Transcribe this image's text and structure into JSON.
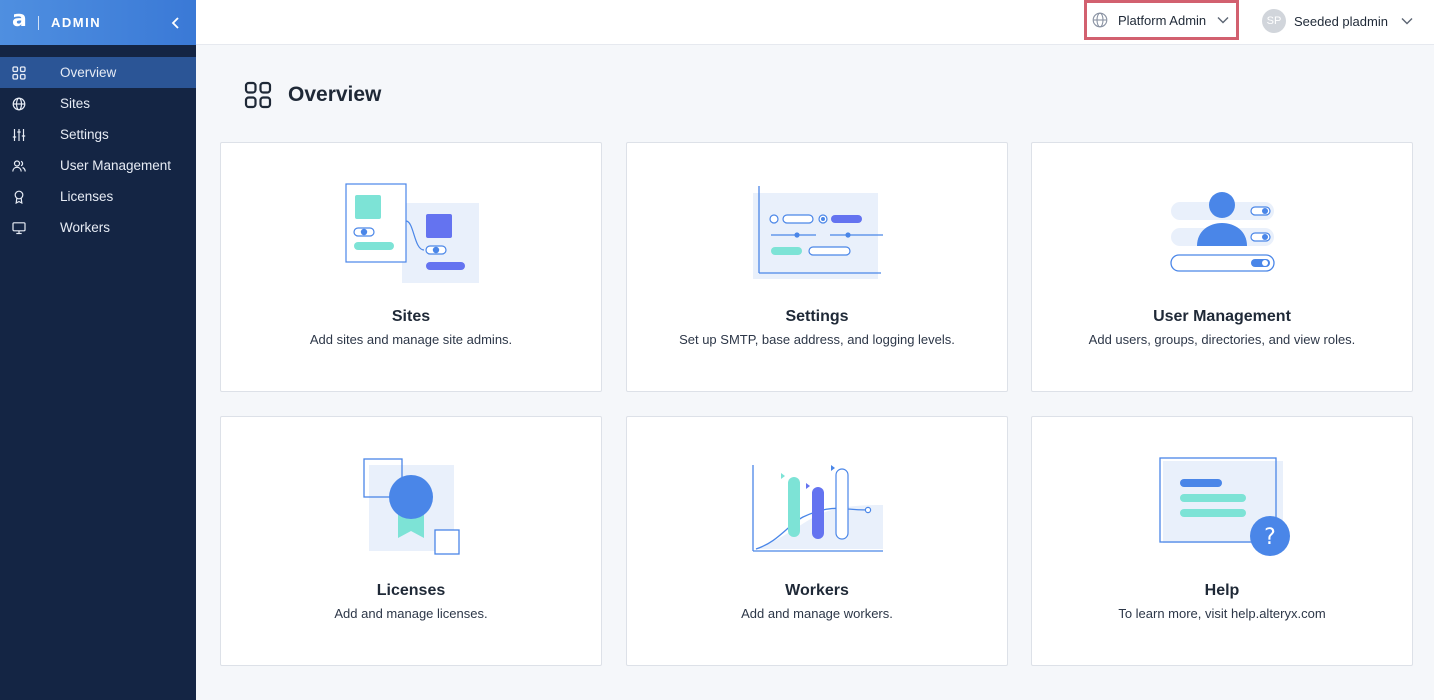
{
  "app": {
    "logo": "a",
    "section": "ADMIN"
  },
  "sidebar": {
    "items": [
      {
        "label": "Overview",
        "icon": "grid-icon",
        "active": true
      },
      {
        "label": "Sites",
        "icon": "globe-icon"
      },
      {
        "label": "Settings",
        "icon": "sliders-icon"
      },
      {
        "label": "User Management",
        "icon": "users-icon"
      },
      {
        "label": "Licenses",
        "icon": "award-icon"
      },
      {
        "label": "Workers",
        "icon": "monitor-icon"
      }
    ]
  },
  "topbar": {
    "context": "Platform Admin",
    "user_initials": "SP",
    "user_name": "Seeded pladmin"
  },
  "main": {
    "title": "Overview",
    "cards": [
      {
        "title": "Sites",
        "desc": "Add sites and manage site admins."
      },
      {
        "title": "Settings",
        "desc": "Set up SMTP, base address, and logging levels."
      },
      {
        "title": "User Management",
        "desc": "Add users, groups, directories, and view roles."
      },
      {
        "title": "Licenses",
        "desc": "Add and manage licenses."
      },
      {
        "title": "Workers",
        "desc": "Add and manage workers."
      },
      {
        "title": "Help",
        "desc": "To learn more, visit help.alteryx.com"
      }
    ]
  },
  "colors": {
    "sidebar_bg": "#142544",
    "sidebar_active": "#2b5596",
    "accent_blue": "#4a86e8",
    "accent_purple": "#6473f0",
    "accent_teal": "#7de3d6",
    "highlight_border": "#d2606f"
  }
}
